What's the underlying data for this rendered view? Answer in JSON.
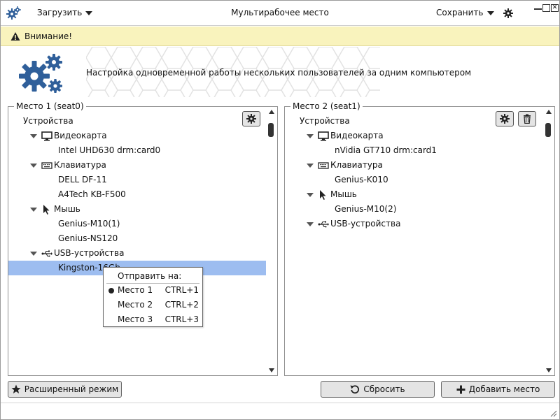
{
  "titlebar": {
    "menu_load": "Загрузить",
    "title": "Мультирабочее место",
    "menu_save": "Сохранить"
  },
  "warning": {
    "text": "Внимание!"
  },
  "banner": {
    "text": "Настройка одновременной работы нескольких пользователей за одним компьютером"
  },
  "seat1": {
    "title": "Место 1 (seat0)",
    "root": "Устройства",
    "video_label": "Видеокарта",
    "video_dev": "Intel UHD630 drm:card0",
    "kbd_label": "Клавиатура",
    "kbd_dev1": "DELL DF-11",
    "kbd_dev2": "A4Tech KB-F500",
    "mouse_label": "Мышь",
    "mouse_dev1": "Genius-M10(1)",
    "mouse_dev2": "Genius-NS120",
    "usb_label": "USB-устройства",
    "usb_dev1": "Kingston-16Gb"
  },
  "seat2": {
    "title": "Место 2 (seat1)",
    "root": "Устройства",
    "video_label": "Видеокарта",
    "video_dev": "nVidia GT710 drm:card1",
    "kbd_label": "Клавиатура",
    "kbd_dev1": "Genius-K010",
    "mouse_label": "Мышь",
    "mouse_dev1": "Genius-M10(2)",
    "usb_label": "USB-устройства"
  },
  "context_menu": {
    "header": "Отправить на:",
    "items": [
      {
        "label": "Место 1",
        "shortcut": "CTRL+1"
      },
      {
        "label": "Место 2",
        "shortcut": "CTRL+2"
      },
      {
        "label": "Место 3",
        "shortcut": "CTRL+3"
      }
    ]
  },
  "buttons": {
    "advanced": "Расширенный режим",
    "reset": "Сбросить",
    "add_seat": "Добавить место"
  },
  "icons": [
    "app-gear-icon",
    "gear-icon",
    "warning-icon",
    "monitor-icon",
    "keyboard-icon",
    "cursor-icon",
    "usb-icon",
    "trash-icon",
    "star-icon",
    "reset-icon",
    "plus-icon"
  ]
}
